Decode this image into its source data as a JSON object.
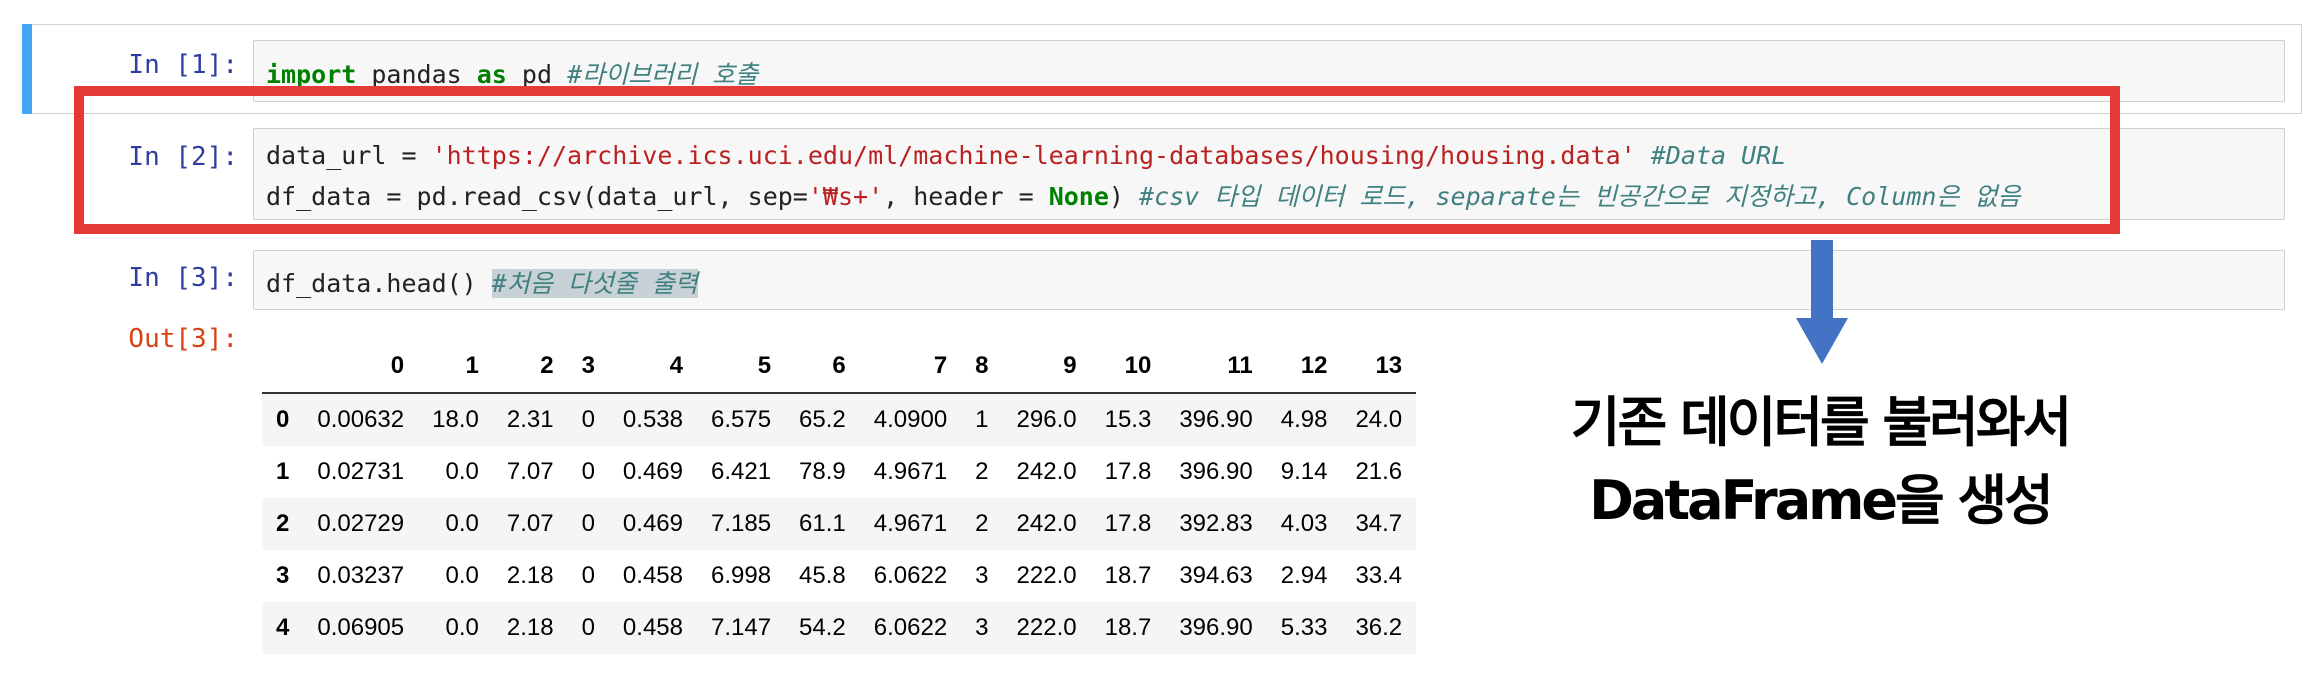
{
  "cells": [
    {
      "prompt": "In [1]:",
      "code": {
        "kw_import": "import",
        "module": " pandas ",
        "kw_as": "as",
        "alias": " pd ",
        "comment": "#라이브러리 호출"
      }
    },
    {
      "prompt": "In [2]:",
      "line1": {
        "var": "data_url = ",
        "url": "'https://archive.ics.uci.edu/ml/machine-learning-databases/housing/housing.data'",
        "space": " ",
        "comment": "#Data URL"
      },
      "line2": {
        "start": "df_data = pd.read_csv(data_url, sep=",
        "sep": "'₩s+'",
        "mid": ", header = ",
        "none": "None",
        "end": ") ",
        "comment": "#csv 타입 데이터 로드, separate는 빈공간으로 지정하고, Column은 없음"
      }
    },
    {
      "prompt": "In [3]:",
      "code": {
        "call": "df_data.head() ",
        "comment": "#처음 다섯줄 출력"
      },
      "out_prompt": "Out[3]:"
    }
  ],
  "table": {
    "columns": [
      "",
      "0",
      "1",
      "2",
      "3",
      "4",
      "5",
      "6",
      "7",
      "8",
      "9",
      "10",
      "11",
      "12",
      "13"
    ],
    "rows": [
      [
        "0",
        "0.00632",
        "18.0",
        "2.31",
        "0",
        "0.538",
        "6.575",
        "65.2",
        "4.0900",
        "1",
        "296.0",
        "15.3",
        "396.90",
        "4.98",
        "24.0"
      ],
      [
        "1",
        "0.02731",
        "0.0",
        "7.07",
        "0",
        "0.469",
        "6.421",
        "78.9",
        "4.9671",
        "2",
        "242.0",
        "17.8",
        "396.90",
        "9.14",
        "21.6"
      ],
      [
        "2",
        "0.02729",
        "0.0",
        "7.07",
        "0",
        "0.469",
        "7.185",
        "61.1",
        "4.9671",
        "2",
        "242.0",
        "17.8",
        "392.83",
        "4.03",
        "34.7"
      ],
      [
        "3",
        "0.03237",
        "0.0",
        "2.18",
        "0",
        "0.458",
        "6.998",
        "45.8",
        "6.0622",
        "3",
        "222.0",
        "18.7",
        "394.63",
        "2.94",
        "33.4"
      ],
      [
        "4",
        "0.06905",
        "0.0",
        "2.18",
        "0",
        "0.458",
        "7.147",
        "54.2",
        "6.0622",
        "3",
        "222.0",
        "18.7",
        "396.90",
        "5.33",
        "36.2"
      ]
    ]
  },
  "annotation": {
    "line1": "기존 데이터를 불러와서",
    "line2": "DataFrame을 생성",
    "box_color": "#e53935",
    "arrow_color": "#4472c4"
  }
}
